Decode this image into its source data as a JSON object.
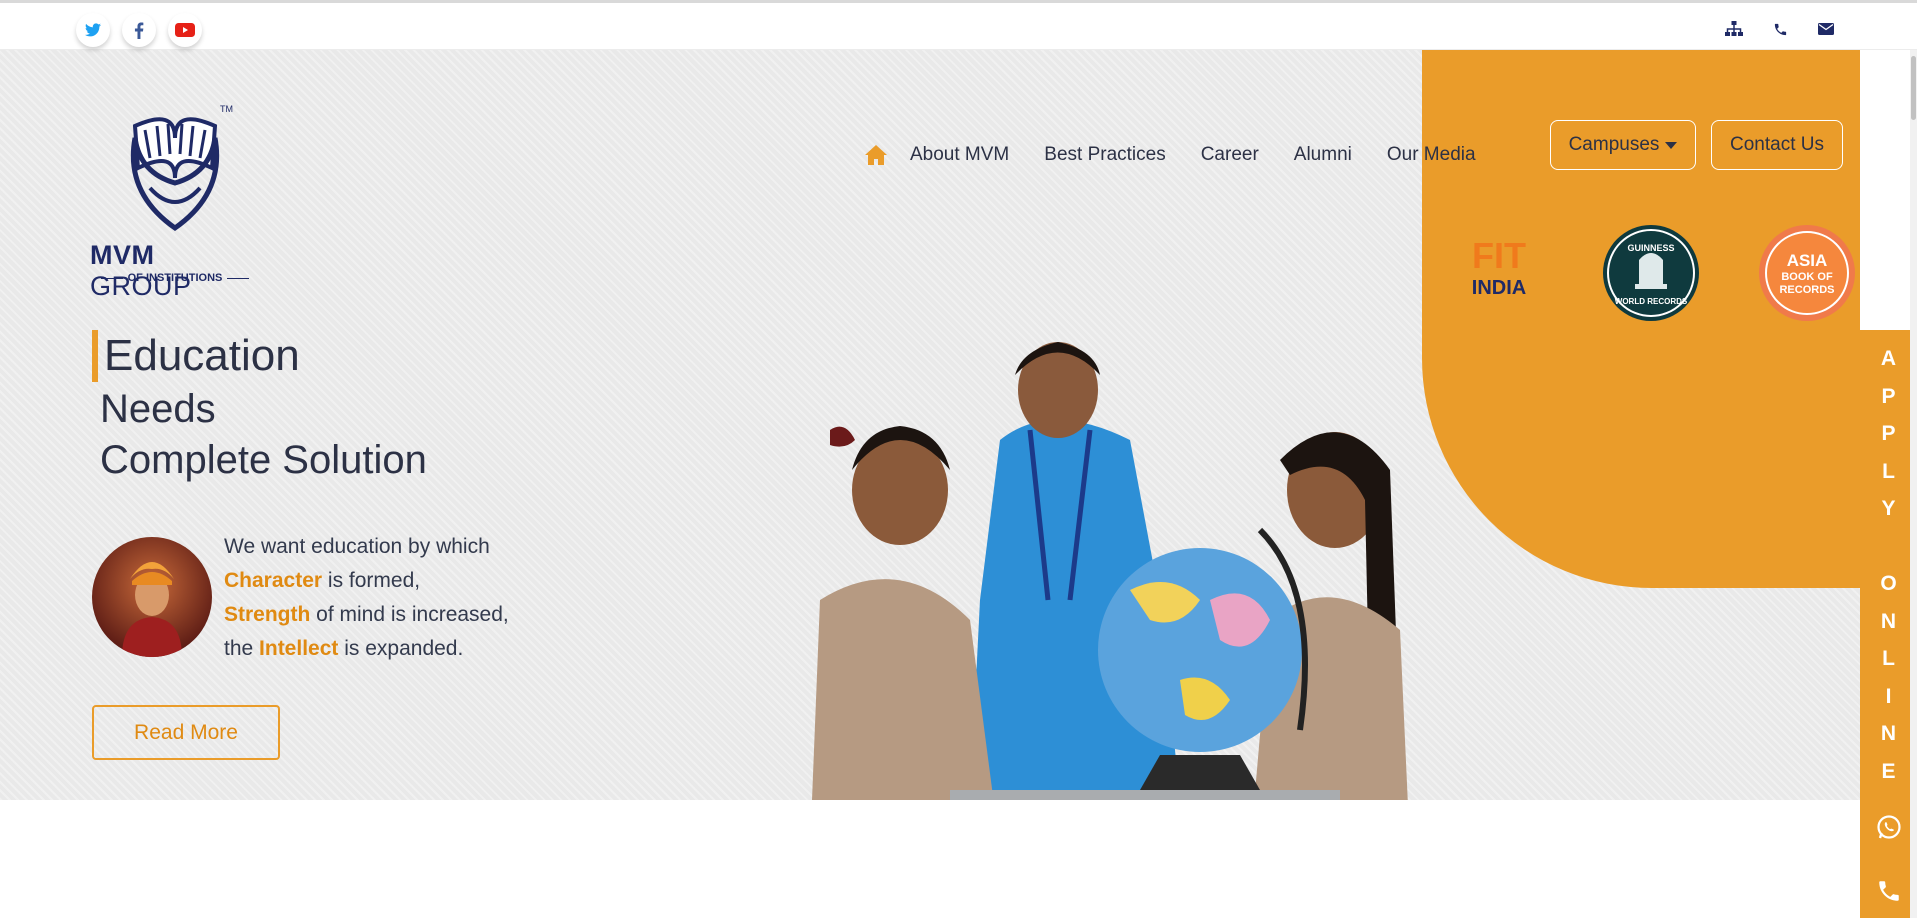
{
  "social": {
    "twitter_icon": "twitter-icon",
    "facebook_icon": "facebook-icon",
    "youtube_icon": "youtube-icon"
  },
  "utility": {
    "sitemap_icon": "sitemap-icon",
    "phone_icon": "phone-icon",
    "mail_icon": "mail-icon"
  },
  "logo": {
    "brand_bold": "MVM",
    "brand_light": " GROUP",
    "sub": "OF INSTITUTIONS",
    "tm": "TM"
  },
  "nav": {
    "home_icon": "home-icon",
    "items": [
      "About MVM",
      "Best Practices",
      "Career",
      "Alumni",
      "Our Media"
    ],
    "campuses": "Campuses",
    "contact": "Contact Us"
  },
  "badges": {
    "fit_top": "FIT",
    "fit_bottom": "INDIA",
    "guinness_top": "GUINNESS",
    "guinness_bottom": "WORLD RECORDS",
    "asia_1": "ASIA",
    "asia_2": "BOOK OF",
    "asia_3": "RECORDS"
  },
  "headline": {
    "line1": "Education",
    "line2": "Needs",
    "line3": "Complete Solution"
  },
  "quote": {
    "p1": "We want education by which",
    "h1": "Character",
    "p2": " is formed,",
    "h2": "Strength",
    "p3": " of mind is increased,",
    "p4": "the ",
    "h3": "Intellect",
    "p5": " is expanded."
  },
  "cta": {
    "read_more": "Read More"
  },
  "apply": {
    "letters": [
      "A",
      "P",
      "P",
      "L",
      "Y",
      "",
      "O",
      "N",
      "L",
      "I",
      "N",
      "E"
    ],
    "whatsapp_icon": "whatsapp-icon",
    "phone_icon": "phone-icon"
  },
  "colors": {
    "accent": "#ea9c2a",
    "text": "#2c3145",
    "brand": "#1f2a66"
  }
}
